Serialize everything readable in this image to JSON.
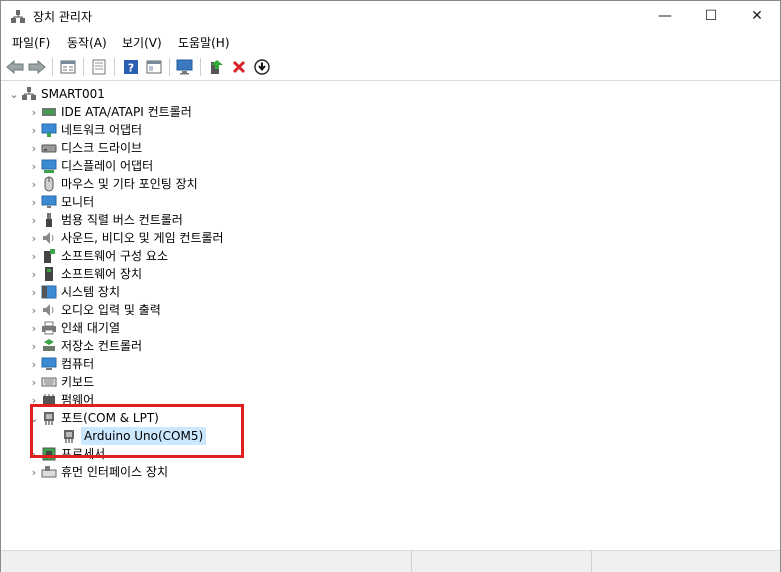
{
  "window": {
    "title": "장치 관리자",
    "controls": {
      "minimize": "—",
      "maximize": "☐",
      "close": "✕"
    }
  },
  "menu": [
    "파일(F)",
    "동작(A)",
    "보기(V)",
    "도움말(H)"
  ],
  "toolbar": [
    "back-icon",
    "forward-icon",
    "properties-pane-icon",
    "device-list-icon",
    "help-icon",
    "action-view-icon",
    "monitor-scan-icon",
    "update-driver-icon",
    "uninstall-icon",
    "download-icon"
  ],
  "tree": {
    "root": "SMART001",
    "items": [
      {
        "label": "IDE ATA/ATAPI 컨트롤러",
        "icon": "ide-controller-icon"
      },
      {
        "label": "네트워크 어댑터",
        "icon": "network-adapter-icon"
      },
      {
        "label": "디스크 드라이브",
        "icon": "disk-drive-icon"
      },
      {
        "label": "디스플레이 어댑터",
        "icon": "display-adapter-icon"
      },
      {
        "label": "마우스 및 기타 포인팅 장치",
        "icon": "mouse-icon"
      },
      {
        "label": "모니터",
        "icon": "monitor-icon"
      },
      {
        "label": "범용 직렬 버스 컨트롤러",
        "icon": "usb-icon"
      },
      {
        "label": "사운드, 비디오 및 게임 컨트롤러",
        "icon": "speaker-icon"
      },
      {
        "label": "소프트웨어 구성 요소",
        "icon": "software-component-icon"
      },
      {
        "label": "소프트웨어 장치",
        "icon": "software-device-icon"
      },
      {
        "label": "시스템 장치",
        "icon": "system-device-icon"
      },
      {
        "label": "오디오 입력 및 출력",
        "icon": "audio-io-icon"
      },
      {
        "label": "인쇄 대기열",
        "icon": "printer-icon"
      },
      {
        "label": "저장소 컨트롤러",
        "icon": "storage-controller-icon"
      },
      {
        "label": "컴퓨터",
        "icon": "computer-icon"
      },
      {
        "label": "키보드",
        "icon": "keyboard-icon"
      },
      {
        "label": "펌웨어",
        "icon": "firmware-icon"
      },
      {
        "label": "포트(COM & LPT)",
        "icon": "port-icon",
        "expanded": true,
        "children": [
          {
            "label": "Arduino Uno(COM5)",
            "icon": "port-icon",
            "selected": true
          }
        ]
      },
      {
        "label": "프로세서",
        "icon": "processor-icon"
      },
      {
        "label": "휴먼 인터페이스 장치",
        "icon": "hid-icon"
      }
    ]
  },
  "colors": {
    "selection": "#cce8ff",
    "highlight_box": "#e02020"
  }
}
